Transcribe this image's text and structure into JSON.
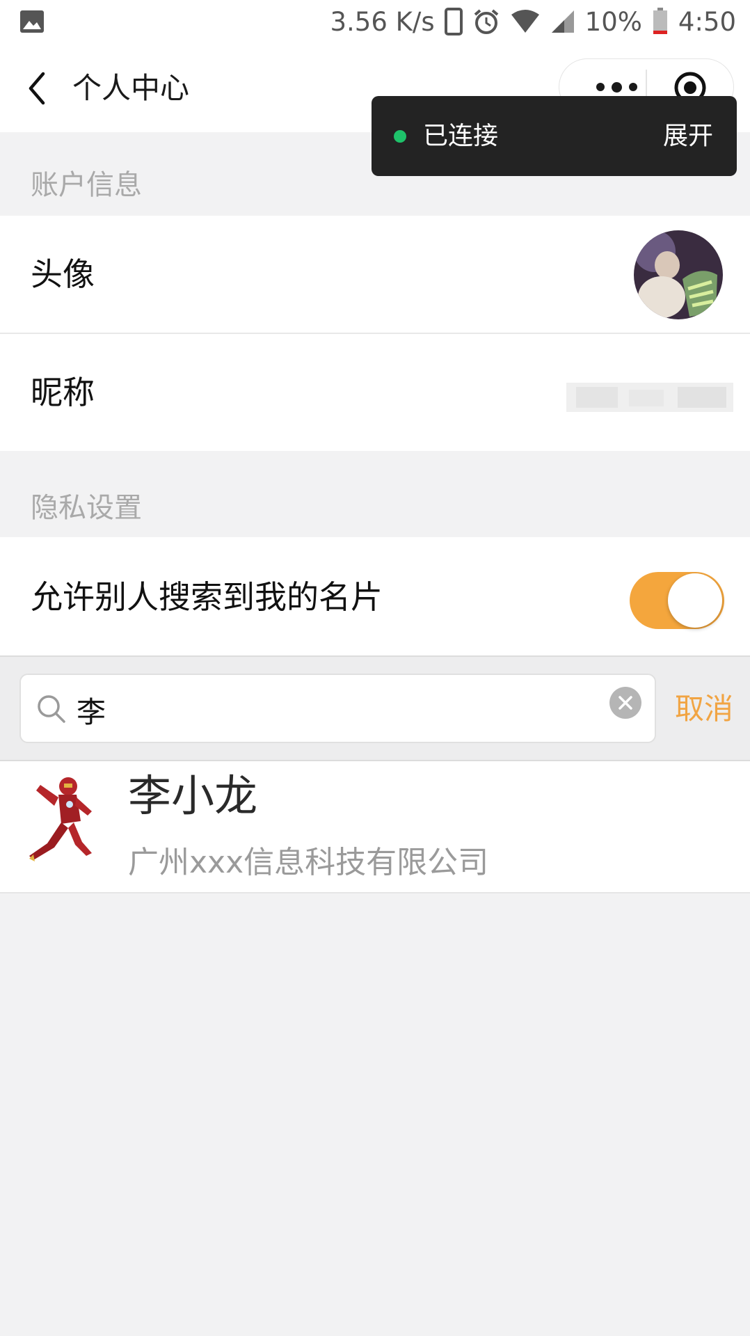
{
  "status_bar": {
    "speed": "3.56 K/s",
    "battery": "10%",
    "time": "4:50",
    "icons": [
      "image-icon",
      "phone-icon",
      "alarm-icon",
      "wifi-icon",
      "signal-icon",
      "battery-icon"
    ]
  },
  "header": {
    "title": "个人中心",
    "more_icon": "more-dots-icon",
    "close_icon": "target-icon"
  },
  "toast": {
    "status": "已连接",
    "expand": "展开",
    "status_color": "#1ec26a"
  },
  "account": {
    "section_title": "账户信息",
    "avatar_label": "头像",
    "nickname_label": "昵称"
  },
  "privacy": {
    "section_title": "隐私设置",
    "allow_search_label": "允许别人搜索到我的名片",
    "allow_search_enabled": true,
    "toggle_color": "#f4a63d"
  },
  "search": {
    "value": "李",
    "cancel_label": "取消",
    "accent_color": "#f1a443"
  },
  "results": [
    {
      "name": "李小龙",
      "company": "广州xxx信息科技有限公司"
    }
  ]
}
